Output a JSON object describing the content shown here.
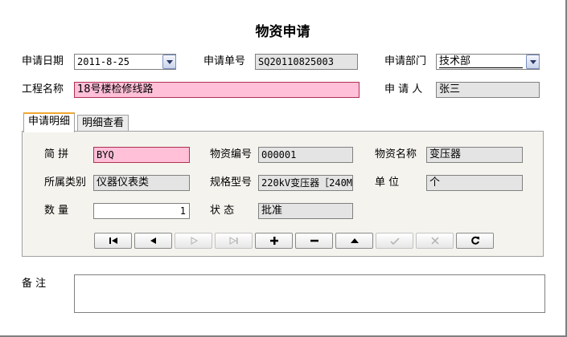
{
  "title": "物资申请",
  "header": {
    "apply_date_label": "申请日期",
    "apply_date_value": "2011-8-25",
    "apply_no_label": "申请单号",
    "apply_no_value": "SQ20110825003",
    "department_label": "申请部门",
    "department_value": "技术部",
    "project_label": "工程名称",
    "project_value": "18号楼检修线路",
    "applicant_label": "申 请 人",
    "applicant_value": "张三"
  },
  "tabs": [
    {
      "label": "申请明细",
      "active": true
    },
    {
      "label": "明细查看",
      "active": false
    }
  ],
  "detail": {
    "short_label": "简    拼",
    "short_value": "BYQ",
    "code_label": "物资编号",
    "code_value": "000001",
    "name_label": "物资名称",
    "name_value": "变压器",
    "category_label": "所属类别",
    "category_value": "仪器仪表类",
    "spec_label": "规格型号",
    "spec_value": "220kV变压器［240M",
    "unit_label": "单    位",
    "unit_value": "个",
    "qty_label": "数    量",
    "qty_value": "1",
    "status_label": "状    态",
    "status_value": "批准"
  },
  "nav_buttons": [
    {
      "icon": "first-record-icon",
      "enabled": true
    },
    {
      "icon": "prev-record-icon",
      "enabled": true
    },
    {
      "icon": "next-record-icon",
      "enabled": false
    },
    {
      "icon": "last-record-icon",
      "enabled": false
    },
    {
      "icon": "add-icon",
      "enabled": true
    },
    {
      "icon": "delete-icon",
      "enabled": true
    },
    {
      "icon": "edit-icon",
      "enabled": true
    },
    {
      "icon": "post-icon",
      "enabled": false
    },
    {
      "icon": "cancel-icon",
      "enabled": false
    },
    {
      "icon": "refresh-icon",
      "enabled": true
    }
  ],
  "remark_label": "备    注",
  "remark_value": "",
  "colors": {
    "required_field_bg": "#ffc0d8",
    "readonly_field_bg": "#e4e4e4",
    "active_tab_accent": "#f0a830",
    "panel_bg": "#f4f3ee"
  }
}
